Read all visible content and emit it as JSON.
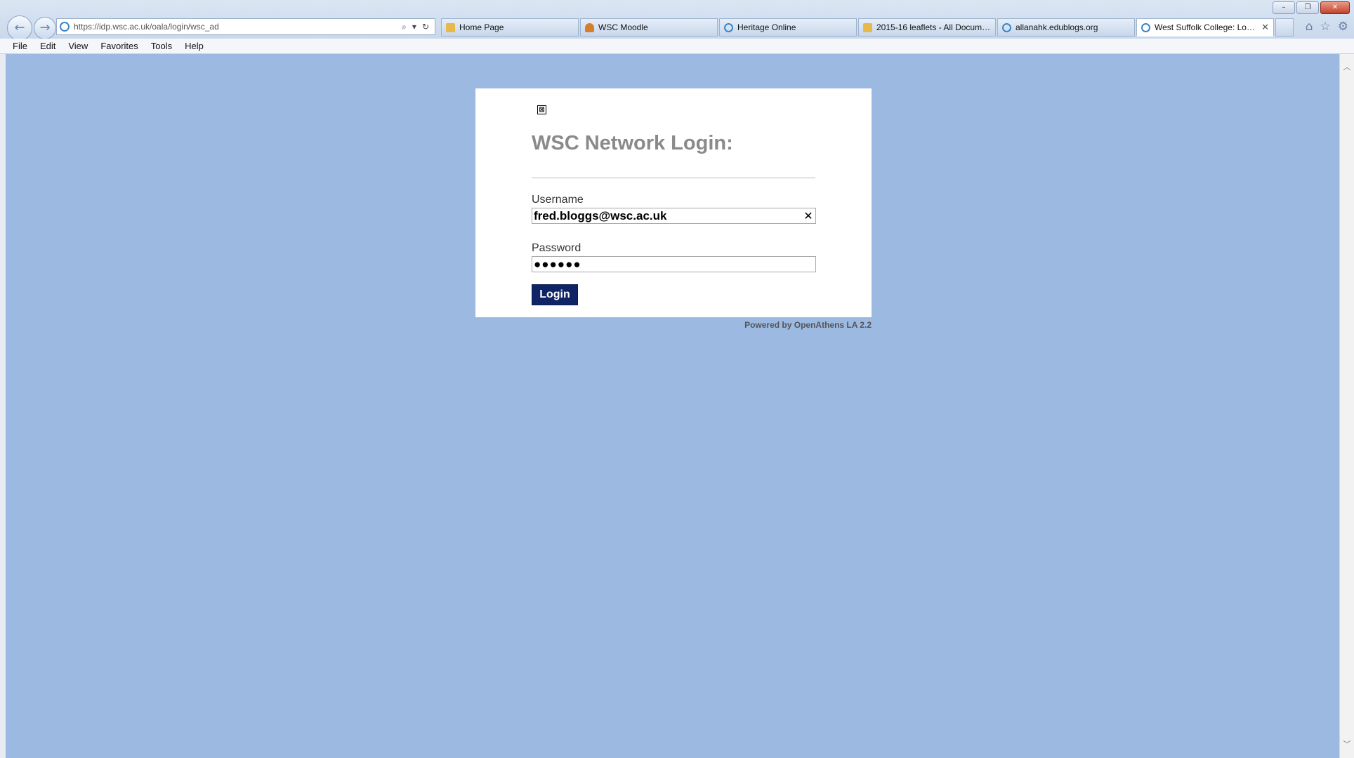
{
  "browser": {
    "address_url": "https://idp.wsc.ac.uk/oala/login/wsc_ad",
    "window_controls": [
      "–",
      "❐",
      "✕"
    ],
    "address_tools": [
      "⌕",
      "▾",
      "↻"
    ],
    "tabs": [
      {
        "label": "Home Page",
        "icon": "sharepoint-icon"
      },
      {
        "label": "WSC Moodle",
        "icon": "moodle-icon"
      },
      {
        "label": "Heritage Online",
        "icon": "ie-page-icon"
      },
      {
        "label": "2015-16 leaflets - All Docume...",
        "icon": "sharepoint-icon"
      },
      {
        "label": "allanahk.edublogs.org",
        "icon": "ie-page-icon"
      },
      {
        "label": "West Suffolk College: Login",
        "icon": "ie-page-icon",
        "active": true
      }
    ],
    "tab_close": "✕",
    "right_tools": [
      "⌂",
      "☆",
      "⚙"
    ],
    "menu": [
      "File",
      "Edit",
      "View",
      "Favorites",
      "Tools",
      "Help"
    ]
  },
  "login": {
    "logo_alt_glyph": "⊠",
    "title": "WSC Network Login:",
    "username_label": "Username",
    "username_value": "fred.bloggs@wsc.ac.uk",
    "clear_glyph": "✕",
    "password_label": "Password",
    "password_value": "●●●●●●",
    "button_label": "Login",
    "powered_by": "Powered by OpenAthens LA 2.2"
  }
}
